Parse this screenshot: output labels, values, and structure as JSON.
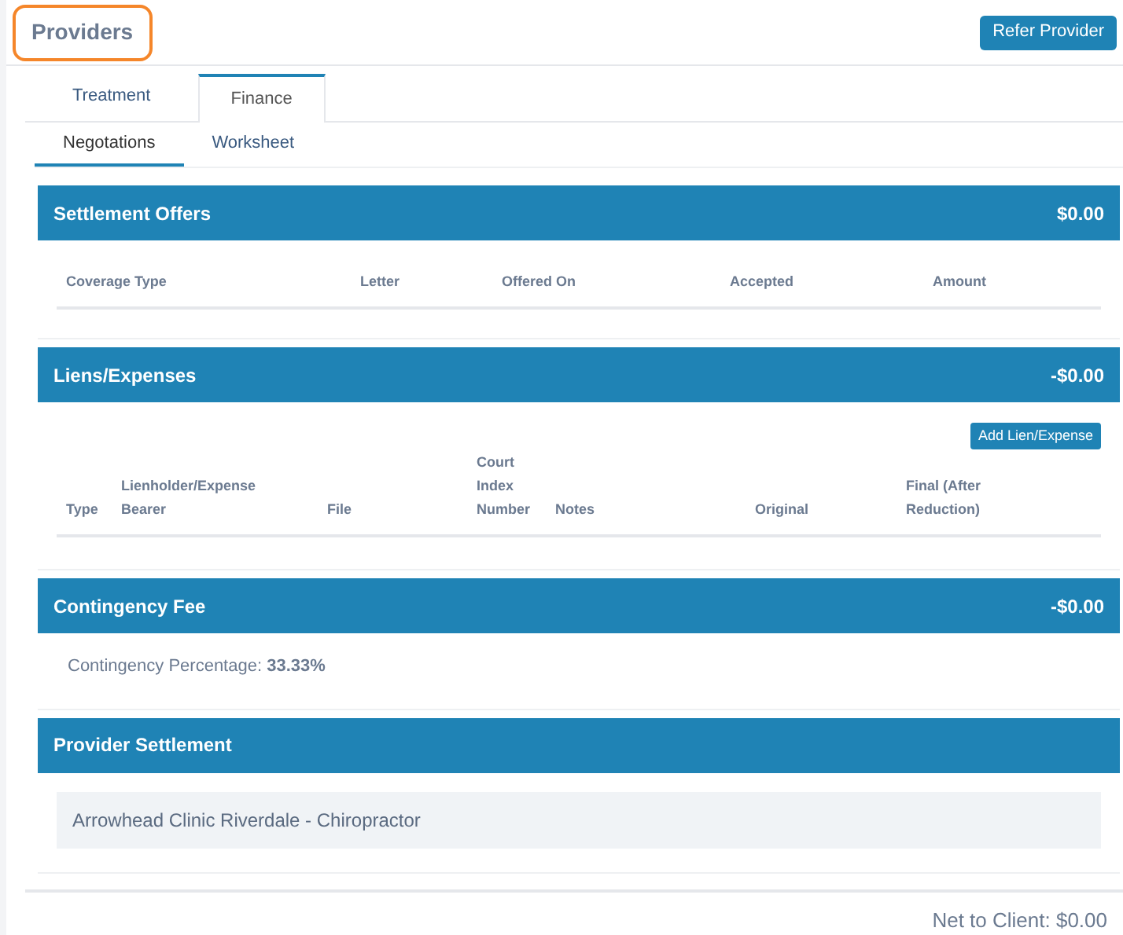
{
  "page": {
    "title": "Providers",
    "title_highlighted": true,
    "action_button": "Refer Provider"
  },
  "tabs": [
    {
      "label": "Treatment",
      "selected": false
    },
    {
      "label": "Finance",
      "selected": true
    }
  ],
  "subtabs": [
    {
      "label": "Negotations",
      "selected": true
    },
    {
      "label": "Worksheet",
      "selected": false
    }
  ],
  "settlement_offers": {
    "title": "Settlement Offers",
    "total": "$0.00",
    "columns": [
      "Coverage Type",
      "Letter",
      "Offered On",
      "Accepted",
      "Amount"
    ]
  },
  "liens_expenses": {
    "title": "Liens/Expenses",
    "total": "-$0.00",
    "add_button": "Add Lien/Expense",
    "columns": [
      "Type",
      "Lienholder/Expense Bearer",
      "File",
      "Court Index Number",
      "Notes",
      "Original",
      "Final (After Reduction)"
    ]
  },
  "contingency_fee": {
    "title": "Contingency Fee",
    "total": "-$0.00",
    "percentage_text": "Contingency Percentage: **33.33%**"
  },
  "provider_settlement": {
    "title": "Provider Settlement",
    "providers": [
      "Arrowhead Clinic Riverdale - Chiropractor"
    ]
  },
  "net_to_client": "Net to Client: $0.00"
}
